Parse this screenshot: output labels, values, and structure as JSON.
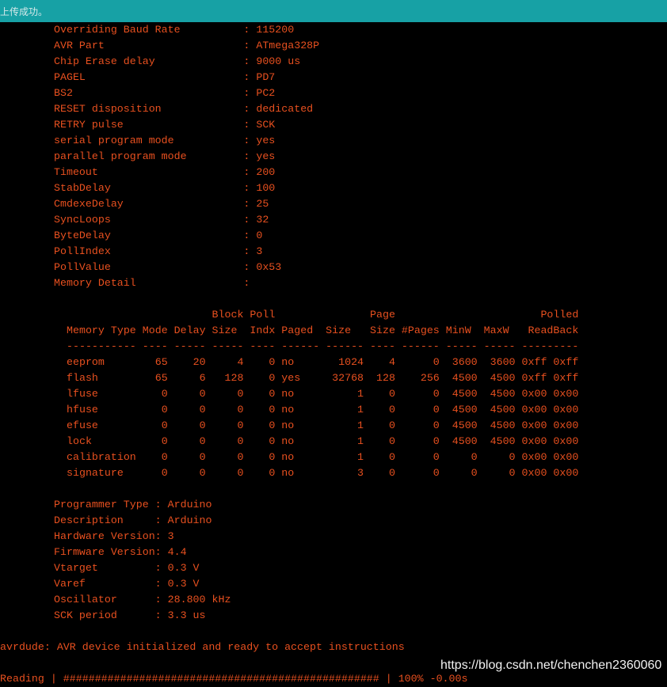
{
  "status_bar": {
    "message": "上传成功。"
  },
  "colors": {
    "status_bar_bg": "#17a1a5",
    "console_bg": "#000000",
    "console_text": "#e8501f"
  },
  "part_info": [
    "Overriding Baud Rate          : 115200",
    "AVR Part                      : ATmega328P",
    "Chip Erase delay              : 9000 us",
    "PAGEL                         : PD7",
    "BS2                           : PC2",
    "RESET disposition             : dedicated",
    "RETRY pulse                   : SCK",
    "serial program mode           : yes",
    "parallel program mode         : yes",
    "Timeout                       : 200",
    "StabDelay                     : 100",
    "CmdexeDelay                   : 25",
    "SyncLoops                     : 32",
    "ByteDelay                     : 0",
    "PollIndex                     : 3",
    "PollValue                     : 0x53",
    "Memory Detail                 :"
  ],
  "memory_table": [
    "                       Block Poll               Page                       Polled",
    "Memory Type Mode Delay Size  Indx Paged  Size   Size #Pages MinW  MaxW   ReadBack",
    "----------- ---- ----- ----- ---- ------ ------ ---- ------ ----- ----- ---------",
    "eeprom        65    20     4    0 no       1024    4      0  3600  3600 0xff 0xff",
    "flash         65     6   128    0 yes     32768  128    256  4500  4500 0xff 0xff",
    "lfuse          0     0     0    0 no          1    0      0  4500  4500 0x00 0x00",
    "hfuse          0     0     0    0 no          1    0      0  4500  4500 0x00 0x00",
    "efuse          0     0     0    0 no          1    0      0  4500  4500 0x00 0x00",
    "lock           0     0     0    0 no          1    0      0  4500  4500 0x00 0x00",
    "calibration    0     0     0    0 no          1    0      0     0     0 0x00 0x00",
    "signature      0     0     0    0 no          3    0      0     0     0 0x00 0x00"
  ],
  "programmer_info": [
    "Programmer Type : Arduino",
    "Description     : Arduino",
    "Hardware Version: 3",
    "Firmware Version: 4.4",
    "Vtarget         : 0.3 V",
    "Varef           : 0.3 V",
    "Oscillator      : 28.800 kHz",
    "SCK period      : 3.3 us"
  ],
  "ready_message": "avrdude: AVR device initialized and ready to accept instructions",
  "reading_line": "Reading | ################################################## | 100% -0.00s",
  "reading_progress_percent": 100,
  "watermark": "https://blog.csdn.net/chenchen2360060"
}
